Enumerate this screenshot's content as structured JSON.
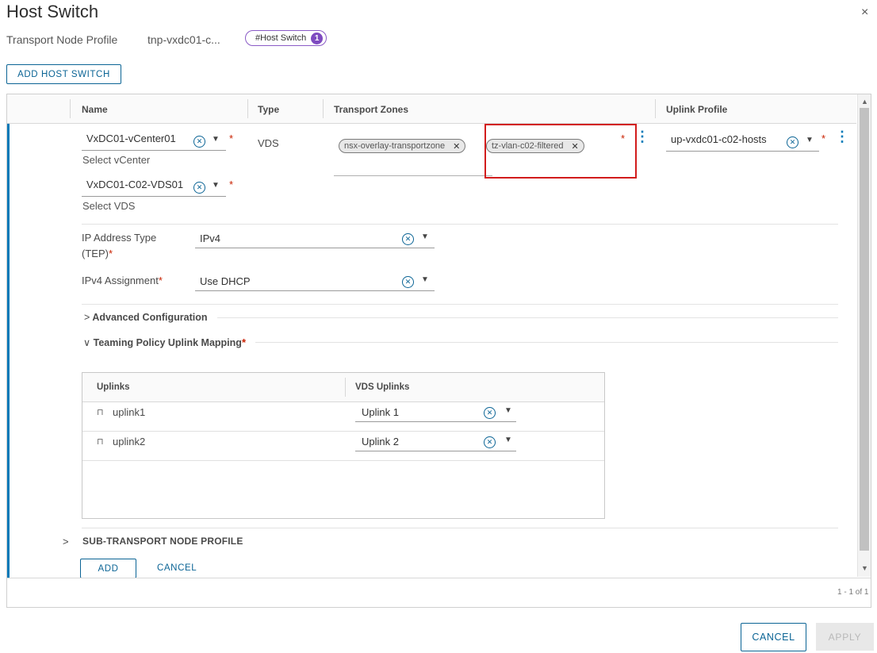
{
  "dialog": {
    "title": "Host Switch",
    "subtitle_label": "Transport Node Profile",
    "profile_name": "tnp-vxdc01-c...",
    "host_switch_tag": "#Host Switch",
    "host_switch_count": "1",
    "add_host_switch_label": "ADD HOST SWITCH",
    "close_glyph": "×"
  },
  "grid": {
    "columns": [
      "Name",
      "Type",
      "Transport Zones",
      "Uplink Profile"
    ],
    "pagination": "1 - 1 of 1"
  },
  "row": {
    "vcenter": {
      "value": "VxDC01-vCenter01",
      "helper": "Select vCenter"
    },
    "vds": {
      "value": "VxDC01-C02-VDS01",
      "helper": "Select VDS"
    },
    "type": "VDS",
    "transport_zones": [
      "nsx-overlay-transportzone",
      "tz-vlan-c02-filtered"
    ],
    "uplink_profile": "up-vxdc01-c02-hosts",
    "ip_address_type": {
      "label_line1": "IP Address Type",
      "label_line2": "(TEP)",
      "value": "IPv4"
    },
    "ipv4_assignment": {
      "label": "IPv4 Assignment",
      "value": "Use DHCP"
    },
    "advanced_config_label": "Advanced Configuration",
    "teaming_label": "Teaming Policy Uplink Mapping",
    "uplinks_table": {
      "headers": [
        "Uplinks",
        "VDS Uplinks"
      ],
      "rows": [
        {
          "uplink": "uplink1",
          "vds_uplink": "Uplink 1"
        },
        {
          "uplink": "uplink2",
          "vds_uplink": "Uplink 2"
        }
      ]
    },
    "sub_tnp_label": "SUB-TRANSPORT NODE PROFILE",
    "add_label": "ADD",
    "cancel_label": "CANCEL"
  },
  "footer": {
    "cancel_label": "CANCEL",
    "apply_label": "APPLY"
  },
  "colors": {
    "accent": "#0079b8",
    "button_blue": "#0b6495",
    "required_red": "#c92100",
    "highlight_red": "#d21c1c",
    "badge_purple": "#7e4bc0"
  },
  "icons": [
    "close-icon",
    "clear-icon",
    "chevron-down-icon",
    "chevron-right-icon",
    "kebab-menu-icon",
    "uplink-port-icon",
    "scroll-up-icon",
    "scroll-down-icon"
  ]
}
